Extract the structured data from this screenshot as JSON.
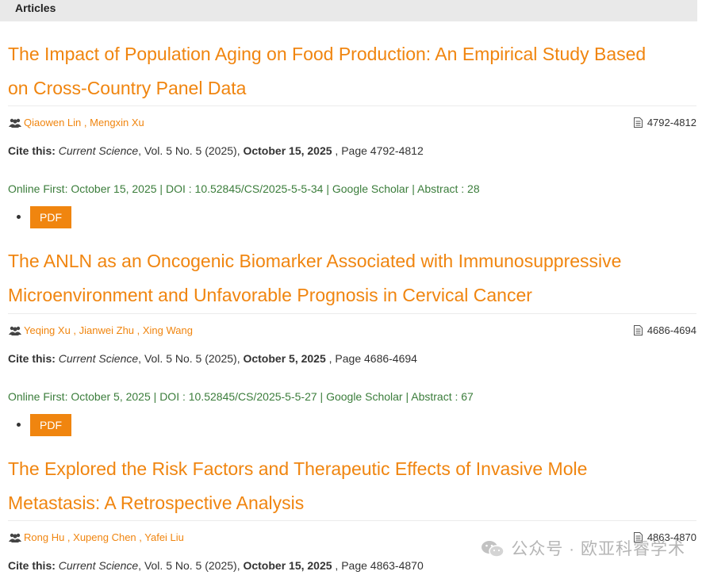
{
  "header": {
    "title": "Articles"
  },
  "articles": [
    {
      "title_line1": "The Impact of Population Aging on Food Production: An Empirical Study Based",
      "title_line2": "on Cross-Country Panel Data",
      "authors": [
        "Qiaowen Lin",
        "Mengxin Xu"
      ],
      "pages_badge": "4792-4812",
      "cite_label": "Cite this:",
      "journal": "Current Science",
      "volume": ", Vol. 5 No. 5 (2025), ",
      "date": "October 15, 2025",
      "page_text": " , Page 4792-4812",
      "online_first": "Online First: October 15, 2025",
      "doi": "DOI : 10.52845/CS/2025-5-5-34",
      "scholar": "Google Scholar",
      "abstract": "Abstract : 28",
      "pdf_label": "PDF"
    },
    {
      "title_line1": "The ANLN as an Oncogenic Biomarker Associated with Immunosuppressive",
      "title_line2": "Microenvironment and Unfavorable Prognosis in Cervical Cancer",
      "authors": [
        "Yeqing Xu",
        "Jianwei Zhu",
        "Xing Wang"
      ],
      "pages_badge": "4686-4694",
      "cite_label": "Cite this:",
      "journal": "Current Science",
      "volume": ", Vol. 5 No. 5 (2025), ",
      "date": "October 5, 2025",
      "page_text": " , Page 4686-4694",
      "online_first": "Online First: October 5, 2025",
      "doi": "DOI : 10.52845/CS/2025-5-5-27",
      "scholar": "Google Scholar",
      "abstract": "Abstract : 67",
      "pdf_label": "PDF"
    },
    {
      "title_line1": "The Explored the Risk Factors and Therapeutic Effects of Invasive Mole",
      "title_line2": "Metastasis: A Retrospective Analysis",
      "authors": [
        "Rong Hu",
        "Xupeng Chen",
        "Yafei Liu"
      ],
      "pages_badge": "4863-4870",
      "cite_label": "Cite this:",
      "journal": "Current Science",
      "volume": ", Vol. 5 No. 5 (2025), ",
      "date": "October 15, 2025",
      "page_text": " , Page 4863-4870"
    }
  ],
  "watermark": {
    "text": "公众号 · 欧亚科睿学术"
  },
  "colors": {
    "accent": "#f0850f",
    "link_green": "#3b7d3b",
    "header_bg": "#e9e9e9"
  }
}
